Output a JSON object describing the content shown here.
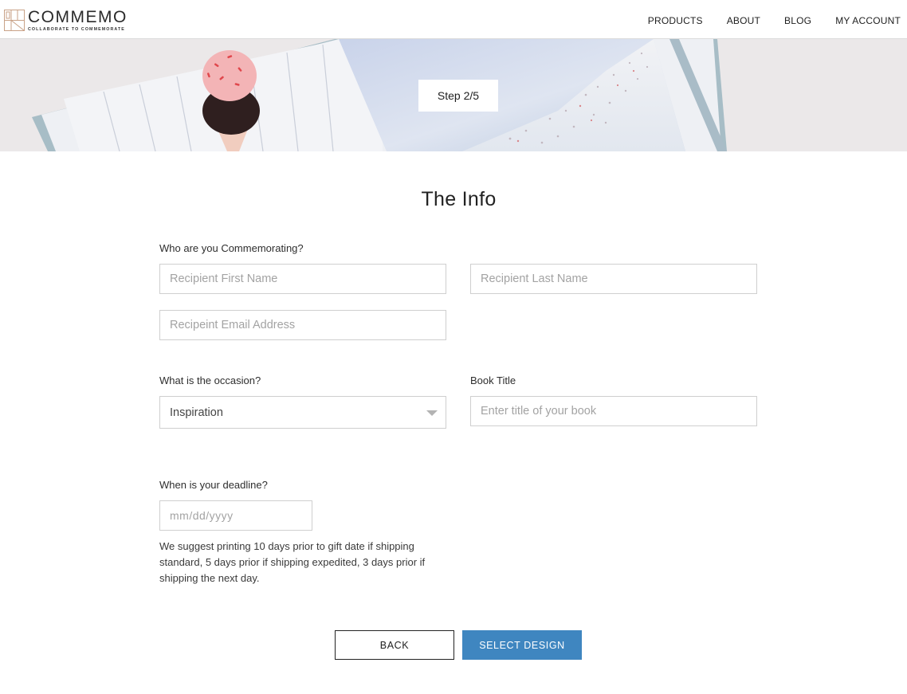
{
  "brand": {
    "name": "COMMEMO",
    "tagline": "COLLABORATE TO COMMEMORATE",
    "accent": "#c9a287"
  },
  "nav": [
    {
      "label": "PRODUCTS"
    },
    {
      "label": "ABOUT"
    },
    {
      "label": "BLOG"
    },
    {
      "label": "MY ACCOUNT"
    }
  ],
  "hero": {
    "step_label": "Step 2/5"
  },
  "form": {
    "title": "The Info",
    "recipient_heading": "Who are you Commemorating?",
    "first_name": {
      "placeholder": "Recipient First Name",
      "value": ""
    },
    "last_name": {
      "placeholder": "Recipient Last Name",
      "value": ""
    },
    "email": {
      "placeholder": "Recipeint Email Address",
      "value": ""
    },
    "occasion_label": "What is the occasion?",
    "occasion_selected": "Inspiration",
    "book_title_label": "Book Title",
    "book_title": {
      "placeholder": "Enter title of your book",
      "value": ""
    },
    "deadline_label": "When is your deadline?",
    "deadline": {
      "placeholder": "mm/dd/yyyy",
      "value": ""
    },
    "deadline_hint": "We suggest printing 10 days prior to gift date if shipping standard, 5 days prior if shipping expedited, 3 days prior if shipping the next day."
  },
  "actions": {
    "back_label": "BACK",
    "next_label": "SELECT DESIGN",
    "primary_color": "#3f86c0"
  }
}
